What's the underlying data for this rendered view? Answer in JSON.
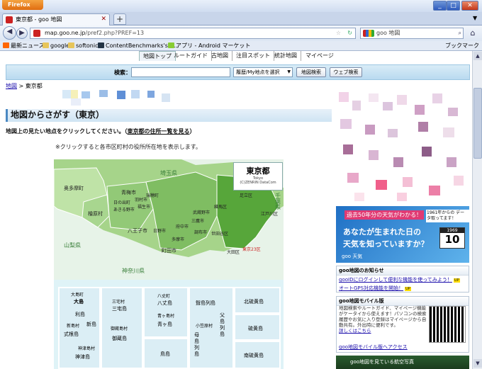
{
  "window": {
    "app_button": "Firefox"
  },
  "tabs": [
    {
      "title": "東京都 - goo 地図"
    }
  ],
  "navbar": {
    "url_host": "map.goo.ne.jp",
    "url_path": "/pref2.php?PREF=13",
    "search_engine_label": "goo 地図"
  },
  "bookmarks": {
    "items": [
      {
        "label": "最新ニュース"
      },
      {
        "label": "google"
      },
      {
        "label": "softonic"
      },
      {
        "label": "ContentBenchmarks's B..."
      },
      {
        "label": "アプリ - Android マーケット"
      }
    ],
    "right_label": "ブックマーク"
  },
  "goo_nav": {
    "items": [
      {
        "label": "地図トップ",
        "active": true
      },
      {
        "label": "ルートガイド"
      },
      {
        "label": "古地図"
      },
      {
        "label": "注目スポット"
      },
      {
        "label": "統計地図"
      },
      {
        "label": "マイページ"
      }
    ]
  },
  "search": {
    "label": "検索：",
    "select_value": "履歴/My地点を選択",
    "map_button": "地図検索",
    "web_button": "ウェブ検索"
  },
  "breadcrumb": {
    "link": "地図",
    "separator": " > ",
    "current": "東京都"
  },
  "heading": "地図からさがす（東京）",
  "instructions": {
    "text": "地図上の見たい地点をクリックしてください。",
    "link": "東京都の住所一覧を見る"
  },
  "note": "※クリックすると各市区町村の役所所在地を表示します。",
  "map": {
    "legend": {
      "title": "東京都",
      "title_en": "Tokyo",
      "copyright": "(C)ZENRIN DataCom"
    },
    "prefectures": [
      {
        "name": "埼玉県"
      },
      {
        "name": "山梨県"
      },
      {
        "name": "神奈川県"
      },
      {
        "name": "千葉県"
      }
    ],
    "special_wards_label": "東京23区",
    "municipalities": [
      {
        "name": "奥多摩町"
      },
      {
        "name": "檜原村"
      },
      {
        "name": "青梅市"
      },
      {
        "name": "日の出町"
      },
      {
        "name": "あきる野市"
      },
      {
        "name": "八王子市"
      },
      {
        "name": "福生市"
      },
      {
        "name": "羽村市"
      },
      {
        "name": "瑞穂町"
      },
      {
        "name": "町田市"
      },
      {
        "name": "日野市"
      },
      {
        "name": "多摩市"
      },
      {
        "name": "府中市"
      },
      {
        "name": "調布市"
      },
      {
        "name": "武蔵野市"
      },
      {
        "name": "三鷹市"
      },
      {
        "name": "世田谷区"
      },
      {
        "name": "大田区"
      },
      {
        "name": "練馬区"
      },
      {
        "name": "足立区"
      },
      {
        "name": "江戸川区"
      }
    ],
    "islands": [
      {
        "name": "大島町"
      },
      {
        "name": "大島"
      },
      {
        "name": "利島"
      },
      {
        "name": "新島"
      },
      {
        "name": "新島村"
      },
      {
        "name": "式根島"
      },
      {
        "name": "神津島"
      },
      {
        "name": "神津島村"
      },
      {
        "name": "三宅村"
      },
      {
        "name": "三宅島"
      },
      {
        "name": "御蔵島村"
      },
      {
        "name": "御蔵島"
      },
      {
        "name": "八丈町"
      },
      {
        "name": "八丈島"
      },
      {
        "name": "青ヶ島村"
      },
      {
        "name": "青ヶ島"
      },
      {
        "name": "鳥島"
      },
      {
        "name": "聟島列島"
      },
      {
        "name": "父島列島"
      },
      {
        "name": "母島列島"
      },
      {
        "name": "小笠原村"
      },
      {
        "name": "北硫黄島"
      },
      {
        "name": "硫黄島"
      },
      {
        "name": "南硫黄島"
      }
    ]
  },
  "banner": {
    "line1": "過去50年分の天気がわかる！",
    "line2": "あなたが生まれた日の",
    "line3": "天気を知っていますか？",
    "since": "1961年からの データ取ってます！",
    "calendar_year": "1969",
    "calendar_day": "10",
    "brand": "goo 天気"
  },
  "news": {
    "title": "goo地図のお知らせ",
    "items": [
      {
        "text": "gooIDにログインして便利な機能を使ってみよう！"
      },
      {
        "text": "オートGPS対応機能を開始！"
      }
    ],
    "badge": "UP"
  },
  "mobile": {
    "title": "goo地図モバイル版",
    "text": "地図検索やルートガイド、マイページ機能がケータイから使えます！パソコンの検索履歴やお気に入り登録はマイページから自動共有。外出時に便利です。",
    "more_link": "詳しくはこちら",
    "access_link": "goo地図モバイル版へアクセス"
  },
  "promo": {
    "text": "goo地図を見ている航空写真"
  }
}
